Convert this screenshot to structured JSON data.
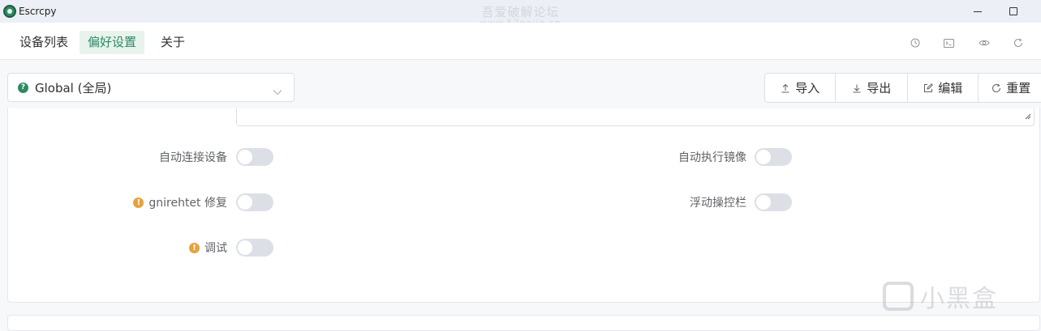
{
  "window": {
    "title": "Escrcpy",
    "watermark_line1": "吾爱破解论坛",
    "watermark_line2": "www.52pojie.cn",
    "minimize_icon": "minimize-icon",
    "maximize_icon": "maximize-icon"
  },
  "nav": {
    "tabs": [
      {
        "label": "设备列表"
      },
      {
        "label": "偏好设置"
      },
      {
        "label": "关于"
      }
    ],
    "active_tab": "偏好设置",
    "tools": [
      "history-icon",
      "terminal-icon",
      "eye-icon",
      "refresh-icon"
    ]
  },
  "preset": {
    "value": "Global (全局)",
    "icon": "question-icon"
  },
  "actions": {
    "import": "导入",
    "export": "导出",
    "edit": "编辑",
    "reset": "重置"
  },
  "settings": {
    "left": [
      {
        "label": "自动连接设备",
        "on": false,
        "warning": false
      },
      {
        "label": "gnirehtet 修复",
        "on": false,
        "warning": true
      },
      {
        "label": "调试",
        "on": false,
        "warning": true
      }
    ],
    "right": [
      {
        "label": "自动执行镜像",
        "on": false
      },
      {
        "label": "浮动操控栏",
        "on": false
      }
    ]
  },
  "brand_watermark": "小黑盒",
  "colors": {
    "accent": "#2f8a63",
    "warning": "#e6a23c",
    "switch_off": "#dcdfe6"
  }
}
